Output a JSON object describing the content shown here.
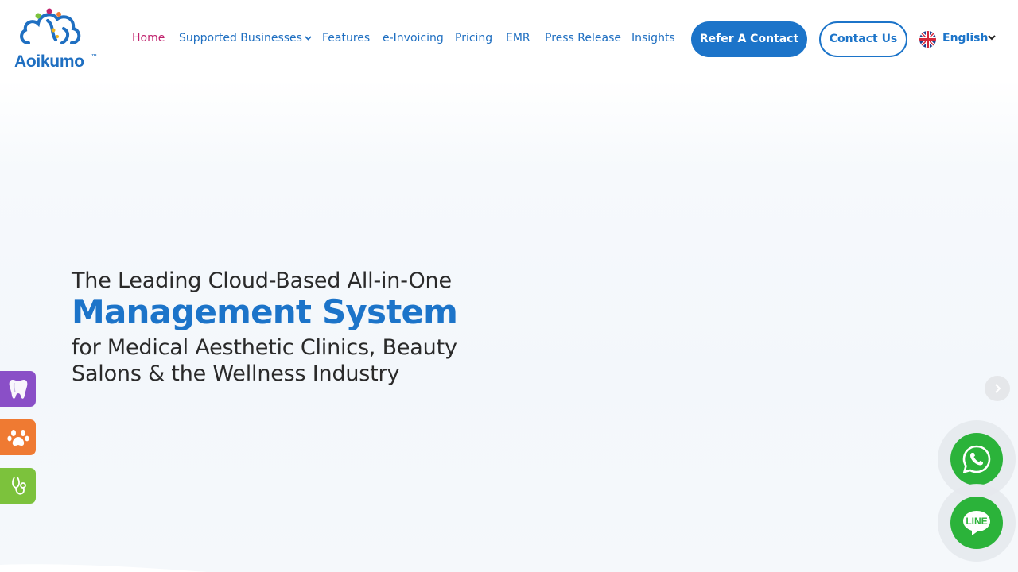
{
  "brand": {
    "name": "Aoikumo",
    "trademark": "™"
  },
  "nav": {
    "items": [
      {
        "label": "Home",
        "active": true
      },
      {
        "label": "Supported Businesses",
        "has_dropdown": true
      },
      {
        "label": "Features"
      },
      {
        "label": "e-Invoicing"
      },
      {
        "label": "Pricing"
      },
      {
        "label": "EMR"
      },
      {
        "label": "Press Release"
      },
      {
        "label": "Insights"
      }
    ]
  },
  "header": {
    "refer_label": "Refer A Contact",
    "contact_label": "Contact Us",
    "language": "English"
  },
  "hero": {
    "line1": "The Leading Cloud-Based All-in-One",
    "line2": "Management System",
    "line3": "for Medical Aesthetic Clinics, Beauty Salons & the Wellness Industry"
  },
  "side_tabs": [
    {
      "icon": "tooth-icon",
      "color": "#8a4fc7"
    },
    {
      "icon": "paw-icon",
      "color": "#ef7a32"
    },
    {
      "icon": "stethoscope-icon",
      "color": "#7cc23c"
    }
  ],
  "floating": {
    "whatsapp_icon": "whatsapp-icon",
    "line_label": "LINE"
  },
  "colors": {
    "primary": "#1c74c9",
    "active_nav": "#c0226d",
    "whatsapp": "#2bb33a"
  }
}
